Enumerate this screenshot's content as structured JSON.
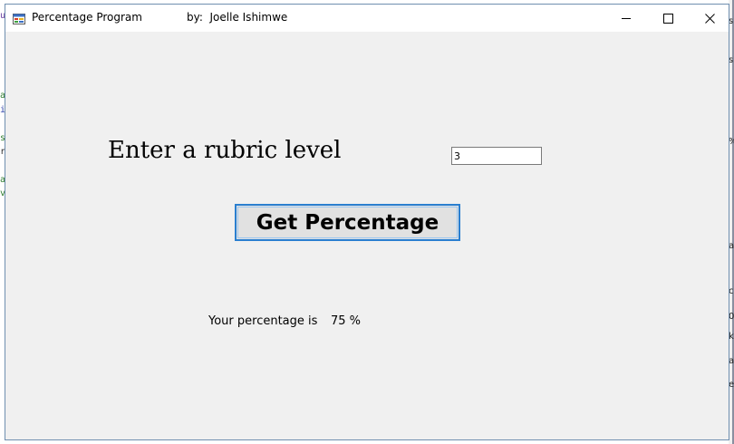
{
  "window": {
    "title": "Percentage Program",
    "author": "by:  Joelle Ishimwe"
  },
  "titlebar_buttons": {
    "minimize_icon": "minimize-icon",
    "maximize_icon": "maximize-icon",
    "close_icon": "close-icon"
  },
  "form": {
    "rubric_label": "Enter a rubric level",
    "rubric_value": "3",
    "button_label": "Get Percentage",
    "result_label": "Your percentage is",
    "result_value": "75 %"
  },
  "background": {
    "left_chars": [
      "u",
      "a",
      "i",
      "s",
      "r",
      "a",
      "v"
    ],
    "right_chars": [
      "s",
      "s",
      "%",
      "a",
      "c",
      "0",
      "k",
      "a",
      "e"
    ]
  },
  "colors": {
    "button_border": "#2a7fd0",
    "window_bg": "#f0f0f0"
  }
}
